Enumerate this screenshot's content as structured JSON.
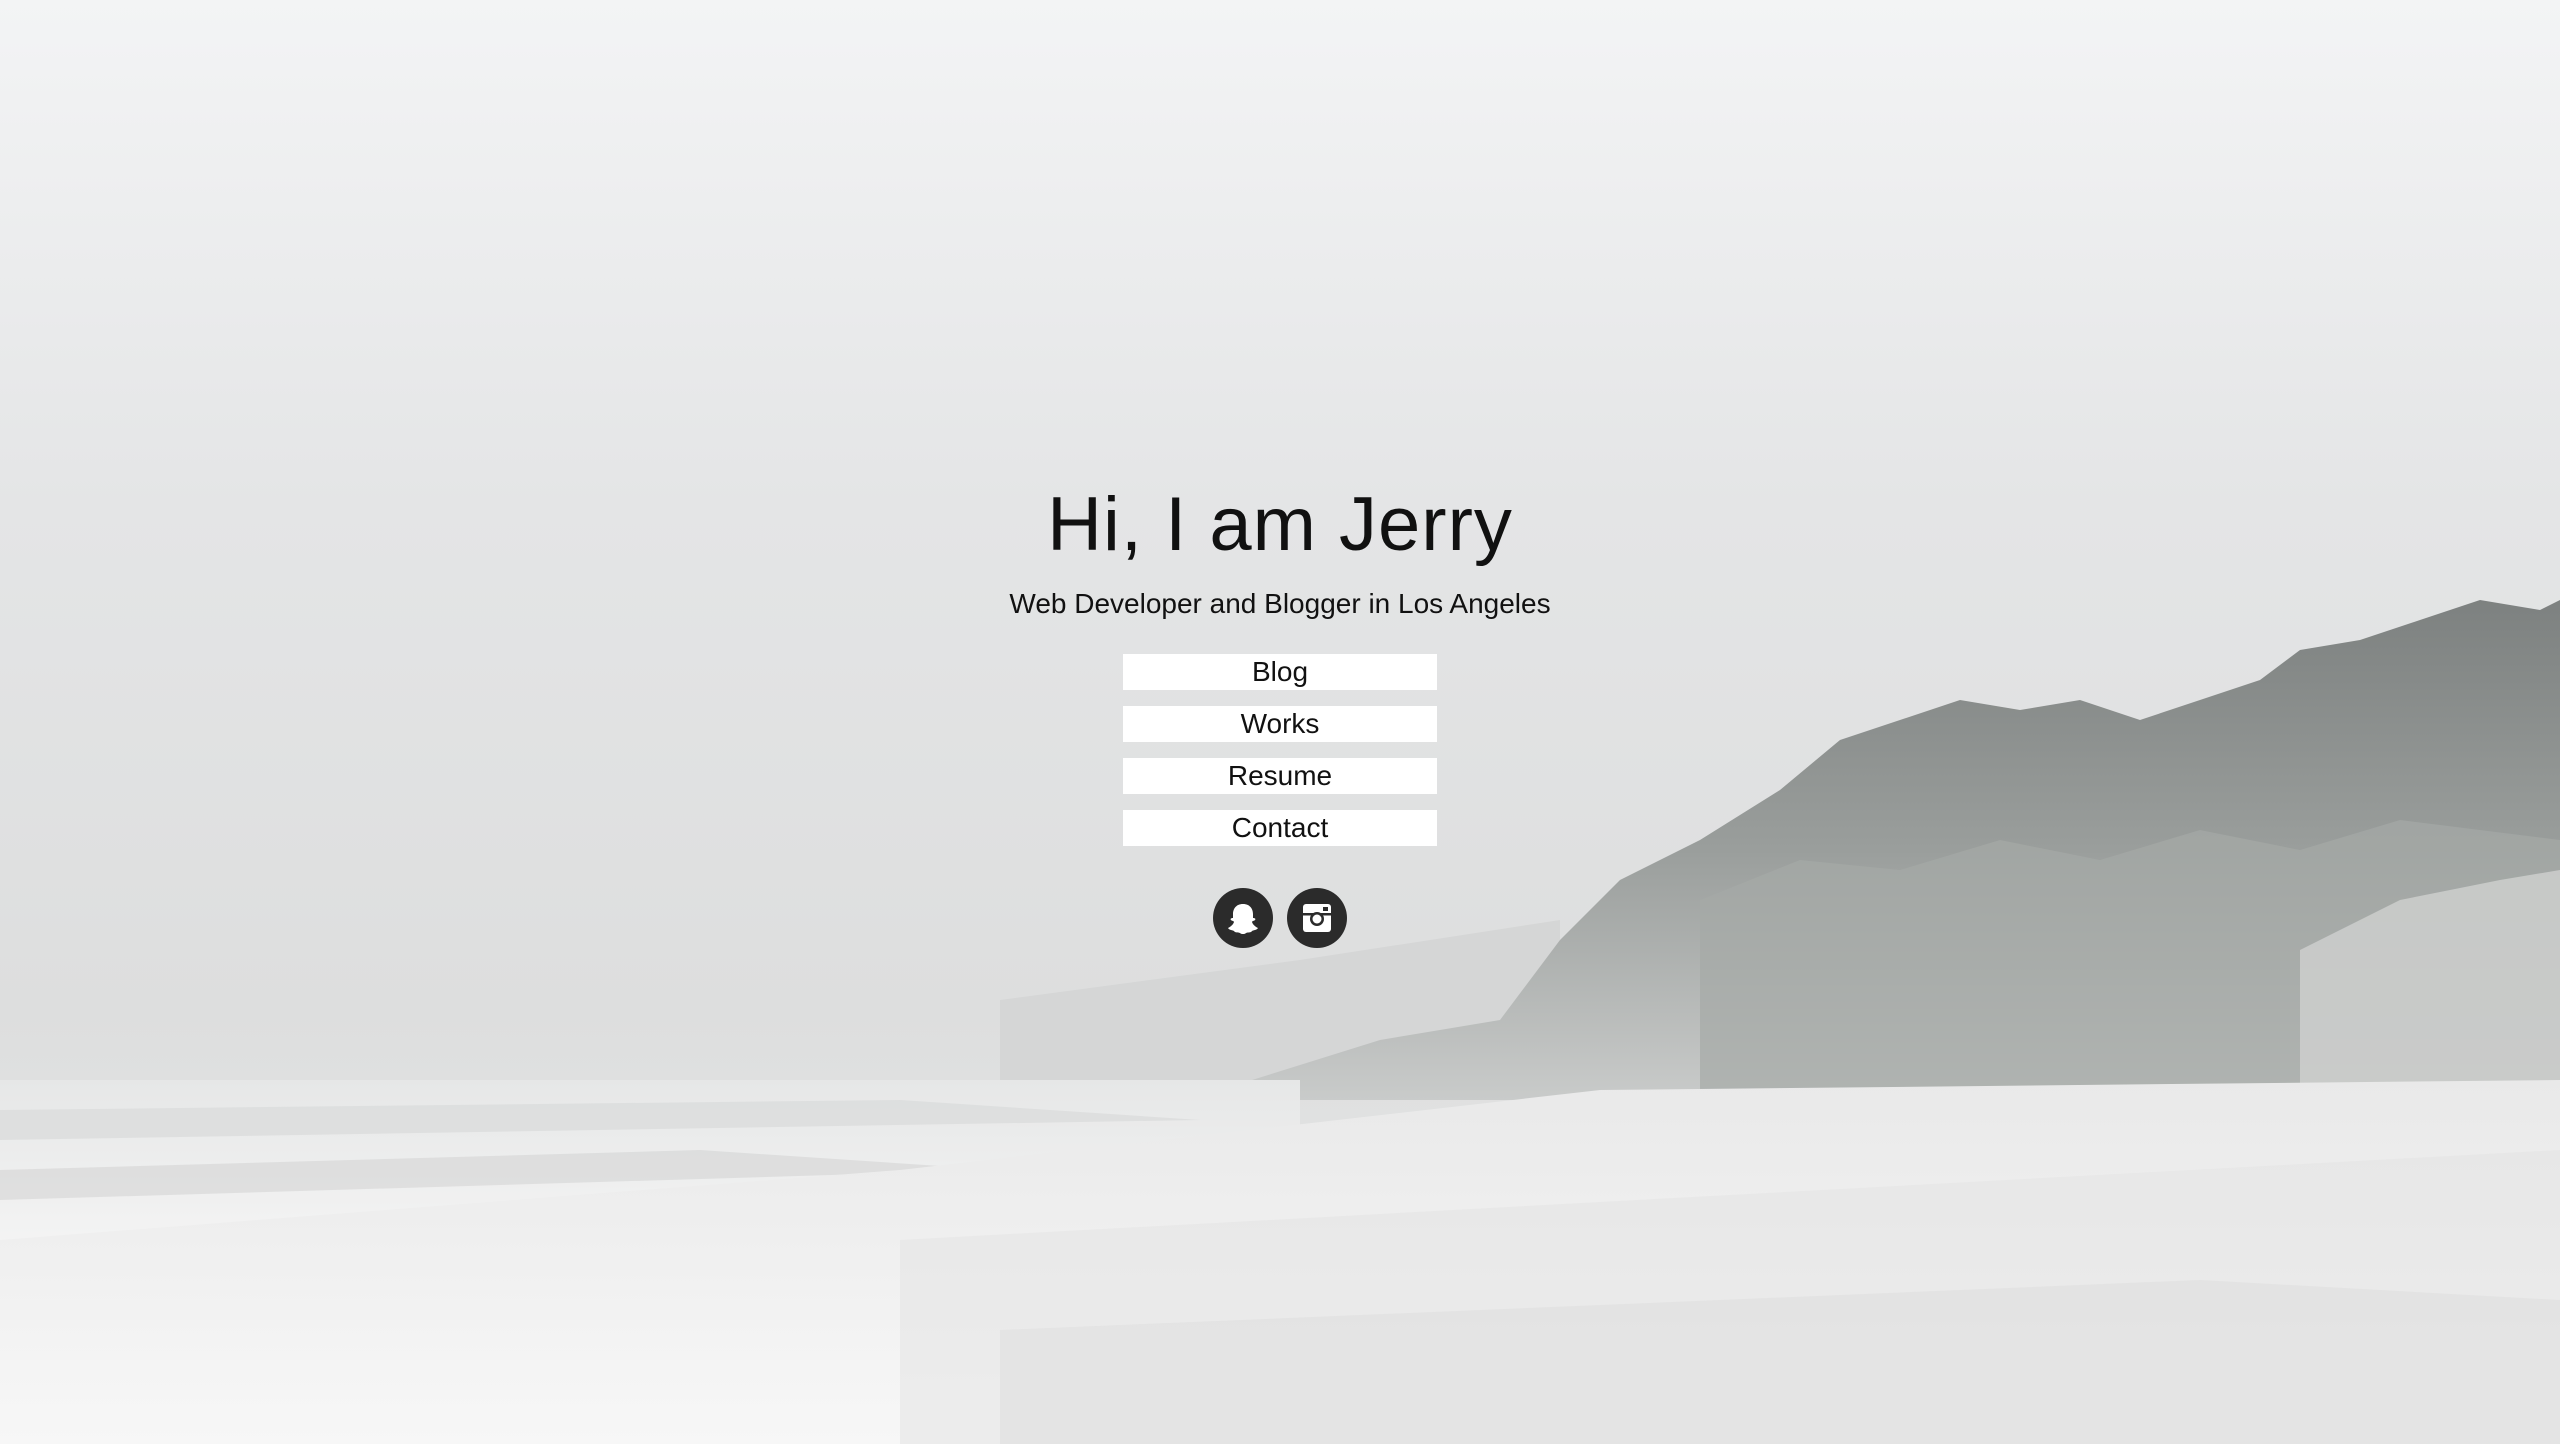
{
  "hero": {
    "title": "Hi, I am Jerry",
    "subtitle": "Web Developer and Blogger in Los Angeles"
  },
  "nav": {
    "items": [
      {
        "label": "Blog"
      },
      {
        "label": "Works"
      },
      {
        "label": "Resume"
      },
      {
        "label": "Contact"
      }
    ]
  },
  "socials": [
    {
      "icon": "snapchat-ghost-icon"
    },
    {
      "icon": "instagram-icon"
    }
  ],
  "colors": {
    "button_background": "#ffffff",
    "text": "#111111",
    "social_circle": "#2b2b2b",
    "sky": "#e6e7e8"
  }
}
